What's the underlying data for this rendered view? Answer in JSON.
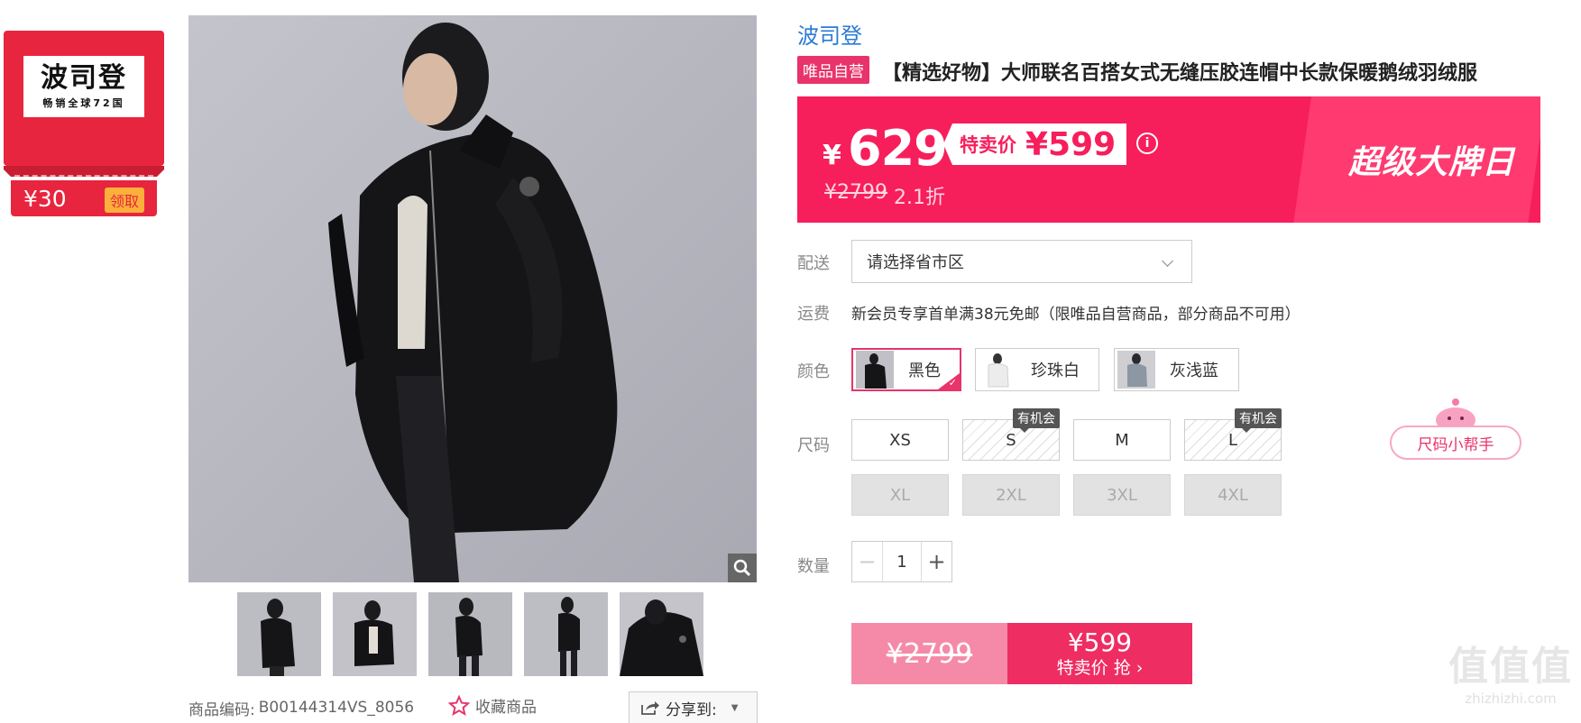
{
  "coupon": {
    "brand": "波司登",
    "tagline": "畅销全球72国",
    "amount": "¥30",
    "claim_label": "领取"
  },
  "gallery": {
    "zoom_icon": "magnifier-icon",
    "thumbnail_count": 5
  },
  "meta": {
    "sku_label": "商品编码:",
    "sku_value": "B00144314VS_8056",
    "favorite_label": "收藏商品",
    "share_label": "分享到:"
  },
  "product": {
    "brand": "波司登",
    "self_badge": "唯品自营",
    "title": "【精选好物】大师联名百搭女式无缝压胶连帽中长款保暖鹅绒羽绒服"
  },
  "price": {
    "currency": "¥",
    "main": "629",
    "special_label": "特卖价",
    "special_value": "¥599",
    "original": "¥2799",
    "discount": "2.1折",
    "slogan": "超级大牌日",
    "info_icon": "info-icon"
  },
  "delivery": {
    "label": "配送",
    "placeholder": "请选择省市区"
  },
  "shipping": {
    "label": "运费",
    "note": "新会员专享首单满38元免邮（限唯品自营商品，部分商品不可用）"
  },
  "colors": {
    "label": "颜色",
    "options": [
      "黑色",
      "珍珠白",
      "灰浅蓝"
    ],
    "selected": "黑色"
  },
  "sizes": {
    "label": "尺码",
    "options": [
      "XS",
      "S",
      "M",
      "L",
      "XL",
      "2XL",
      "3XL",
      "4XL"
    ],
    "chance_tag": "有机会",
    "helper_label": "尺码小帮手"
  },
  "quantity": {
    "label": "数量",
    "value": "1",
    "minus": "−",
    "plus": "+"
  },
  "buy": {
    "original": "¥2799",
    "price": "¥599",
    "cta": "特卖价 抢 ›"
  },
  "watermark": {
    "logo": "值值值",
    "url": "zhizhizhi.com"
  },
  "colors_theme": {
    "accent": "#ee2d63",
    "banner": "#f71e5c",
    "link": "#2a7ad6"
  }
}
